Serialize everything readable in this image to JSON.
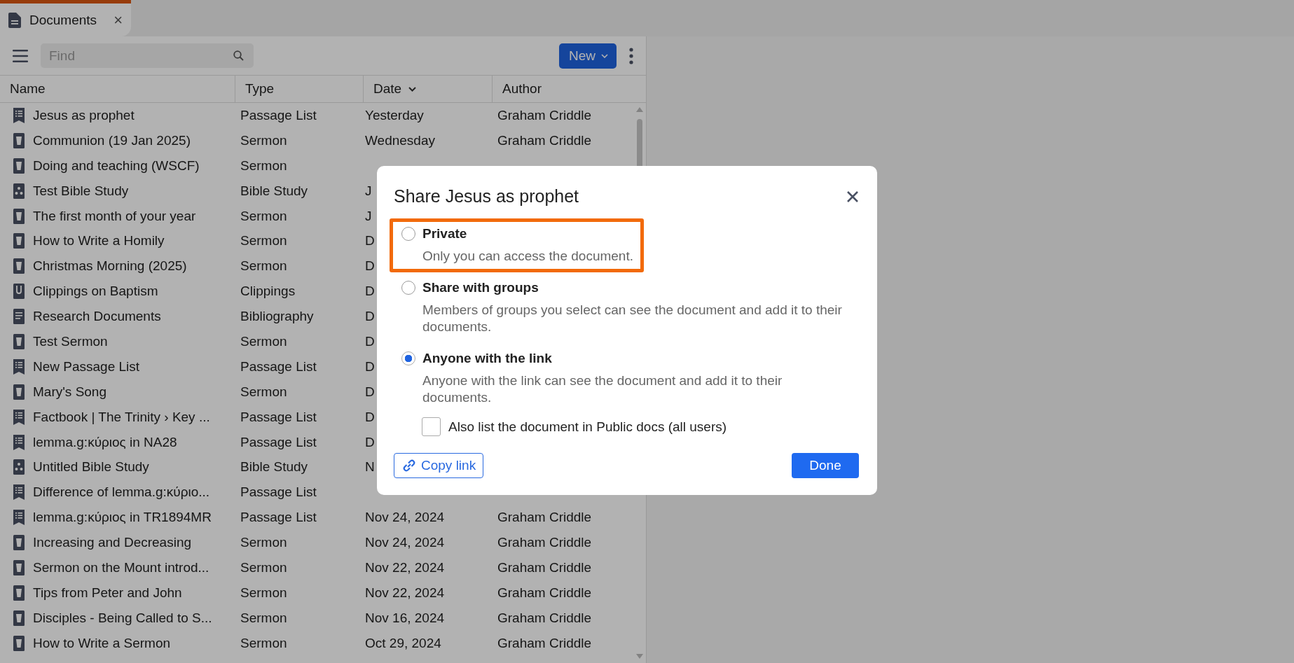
{
  "tab": {
    "title": "Documents",
    "close": "×",
    "selected": true
  },
  "toolbar": {
    "search": {
      "placeholder": "Find"
    },
    "new_button": "New"
  },
  "table": {
    "columns": [
      {
        "label": "Name",
        "sorted": false
      },
      {
        "label": "Type",
        "sorted": false
      },
      {
        "label": "Date",
        "sorted": true
      },
      {
        "label": "Author",
        "sorted": false
      }
    ],
    "rows": [
      {
        "kind": "passage-list",
        "name": "Jesus as prophet",
        "type": "Passage List",
        "date": "Yesterday",
        "author": "Graham Criddle"
      },
      {
        "kind": "sermon",
        "name": "Communion (19 Jan 2025)",
        "type": "Sermon",
        "date": "Wednesday",
        "author": "Graham Criddle"
      },
      {
        "kind": "sermon",
        "name": "Doing and teaching (WSCF)",
        "type": "Sermon"
      },
      {
        "kind": "bible-study",
        "name": "Test Bible Study",
        "type": "Bible Study",
        "date": "J"
      },
      {
        "kind": "sermon",
        "name": "The first month of your year",
        "type": "Sermon",
        "date": "J"
      },
      {
        "kind": "sermon",
        "name": "How to Write a Homily",
        "type": "Sermon",
        "date": "D"
      },
      {
        "kind": "sermon",
        "name": "Christmas Morning (2025)",
        "type": "Sermon",
        "date": "D"
      },
      {
        "kind": "clippings",
        "name": "Clippings on Baptism",
        "type": "Clippings",
        "date": "D"
      },
      {
        "kind": "bibliography",
        "name": "Research Documents",
        "type": "Bibliography",
        "date": "D"
      },
      {
        "kind": "sermon",
        "name": "Test Sermon",
        "type": "Sermon",
        "date": "D"
      },
      {
        "kind": "passage-list",
        "name": "New Passage List",
        "type": "Passage List",
        "date": "D"
      },
      {
        "kind": "sermon",
        "name": "Mary's Song",
        "type": "Sermon",
        "date": "D"
      },
      {
        "kind": "passage-list",
        "name": "Factbook | The Trinity › Key ...",
        "type": "Passage List",
        "date": "D"
      },
      {
        "kind": "passage-list",
        "name": "lemma.g:κύριος in NA28",
        "type": "Passage List",
        "date": "D"
      },
      {
        "kind": "bible-study",
        "name": "Untitled Bible Study",
        "type": "Bible Study",
        "date": "N"
      },
      {
        "kind": "passage-list",
        "name": "Difference of lemma.g:κύριο...",
        "type": "Passage List"
      },
      {
        "kind": "passage-list",
        "name": "lemma.g:κύριος in TR1894MR",
        "type": "Passage List",
        "date": "Nov 24, 2024",
        "author": "Graham Criddle"
      },
      {
        "kind": "sermon",
        "name": "Increasing and Decreasing",
        "type": "Sermon",
        "date": "Nov 24, 2024",
        "author": "Graham Criddle"
      },
      {
        "kind": "sermon",
        "name": "Sermon on the Mount introd...",
        "type": "Sermon",
        "date": "Nov 22, 2024",
        "author": "Graham Criddle"
      },
      {
        "kind": "sermon",
        "name": "Tips from Peter and John",
        "type": "Sermon",
        "date": "Nov 22, 2024",
        "author": "Graham Criddle"
      },
      {
        "kind": "sermon",
        "name": "Disciples - Being Called to S...",
        "type": "Sermon",
        "date": "Nov 16, 2024",
        "author": "Graham Criddle"
      },
      {
        "kind": "sermon",
        "name": "How to Write a Sermon",
        "type": "Sermon",
        "date": "Oct 29, 2024",
        "author": "Graham Criddle"
      }
    ]
  },
  "dialog": {
    "title": "Share Jesus as prophet",
    "options": [
      {
        "label": "Private",
        "description": "Only you can access the document.",
        "selected": false,
        "highlighted": true
      },
      {
        "label": "Share with groups",
        "description": "Members of groups you select can see the document and add it to their documents.",
        "selected": false,
        "highlighted": false
      },
      {
        "label": "Anyone with the link",
        "description": "Anyone with the link can see the document and add it to their documents.",
        "selected": true,
        "highlighted": false
      }
    ],
    "public_listing": {
      "label": "Also list the document in Public docs (all users)",
      "checked": false
    },
    "copy_button": "Copy link",
    "done_button": "Done"
  }
}
